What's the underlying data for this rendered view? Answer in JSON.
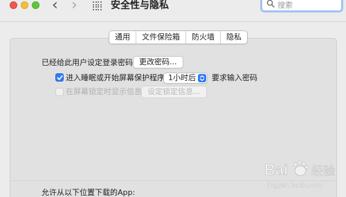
{
  "window": {
    "title": "安全性与隐私",
    "search_placeholder": "搜索"
  },
  "tabs": [
    "通用",
    "文件保险箱",
    "防火墙",
    "隐私"
  ],
  "general": {
    "password_set_label": "已经给此用户设定登录密码",
    "change_password_button": "更改密码...",
    "require_password": {
      "checked": true,
      "label": "进入睡眠或开始屏幕保护程序",
      "delay_value": "1小时后",
      "suffix": "要求输入密码"
    },
    "lock_message": {
      "checked": false,
      "enabled": false,
      "label": "在屏幕锁定时显示信息",
      "button": "设定锁定信息..."
    },
    "allow_apps_label": "允许从以下位置下载的App:"
  },
  "watermark": {
    "brand": "Bai",
    "brand_suffix": "经验",
    "url": "jingyan.baidu.com"
  },
  "colors": {
    "accent": "#2f7cf6",
    "search_focus": "#a3c1f4"
  }
}
